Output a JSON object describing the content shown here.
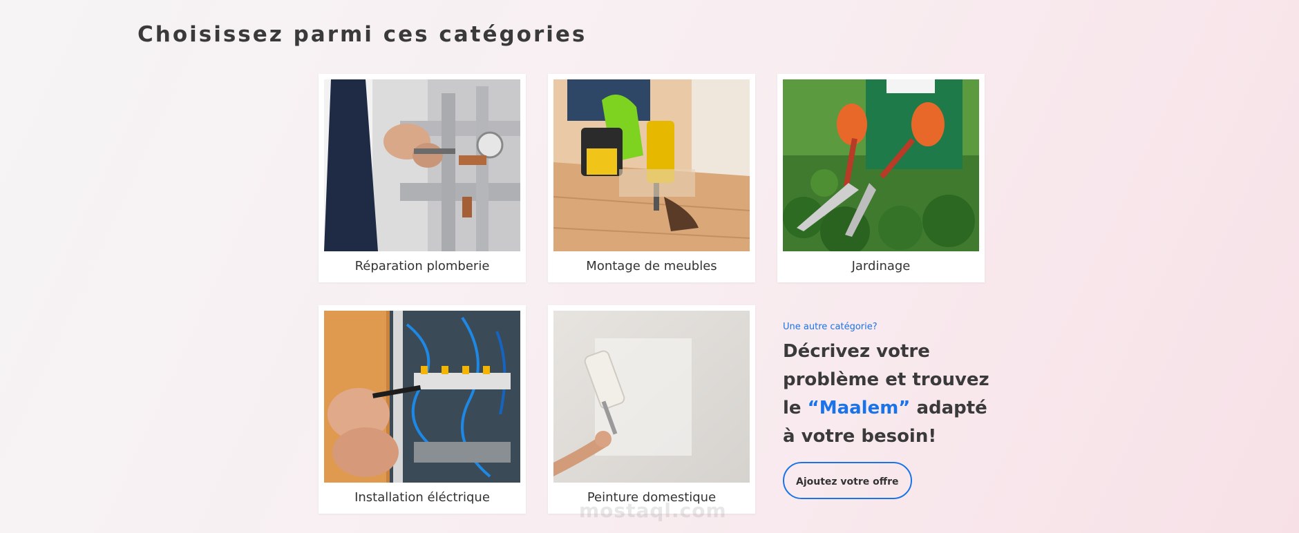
{
  "section": {
    "title": "Choisissez parmi ces catégories"
  },
  "categories": [
    {
      "label": "Réparation plomberie",
      "icon": "plumbing-photo"
    },
    {
      "label": "Montage de meubles",
      "icon": "furniture-assembly-photo"
    },
    {
      "label": "Jardinage",
      "icon": "gardening-photo"
    },
    {
      "label": "Installation éléctrique",
      "icon": "electrical-photo"
    },
    {
      "label": "Peinture domestique",
      "icon": "painting-photo"
    }
  ],
  "promo": {
    "kicker": "Une autre catégorie?",
    "headline_before": "Décrivez votre problème et trouvez le ",
    "headline_brand": "“Maalem”",
    "headline_after": " adapté à votre besoin!",
    "cta_label": "Ajoutez votre offre"
  },
  "watermark": "mostaql.com",
  "colors": {
    "accent": "#1a73e8",
    "text": "#333333",
    "card_bg": "#ffffff"
  }
}
